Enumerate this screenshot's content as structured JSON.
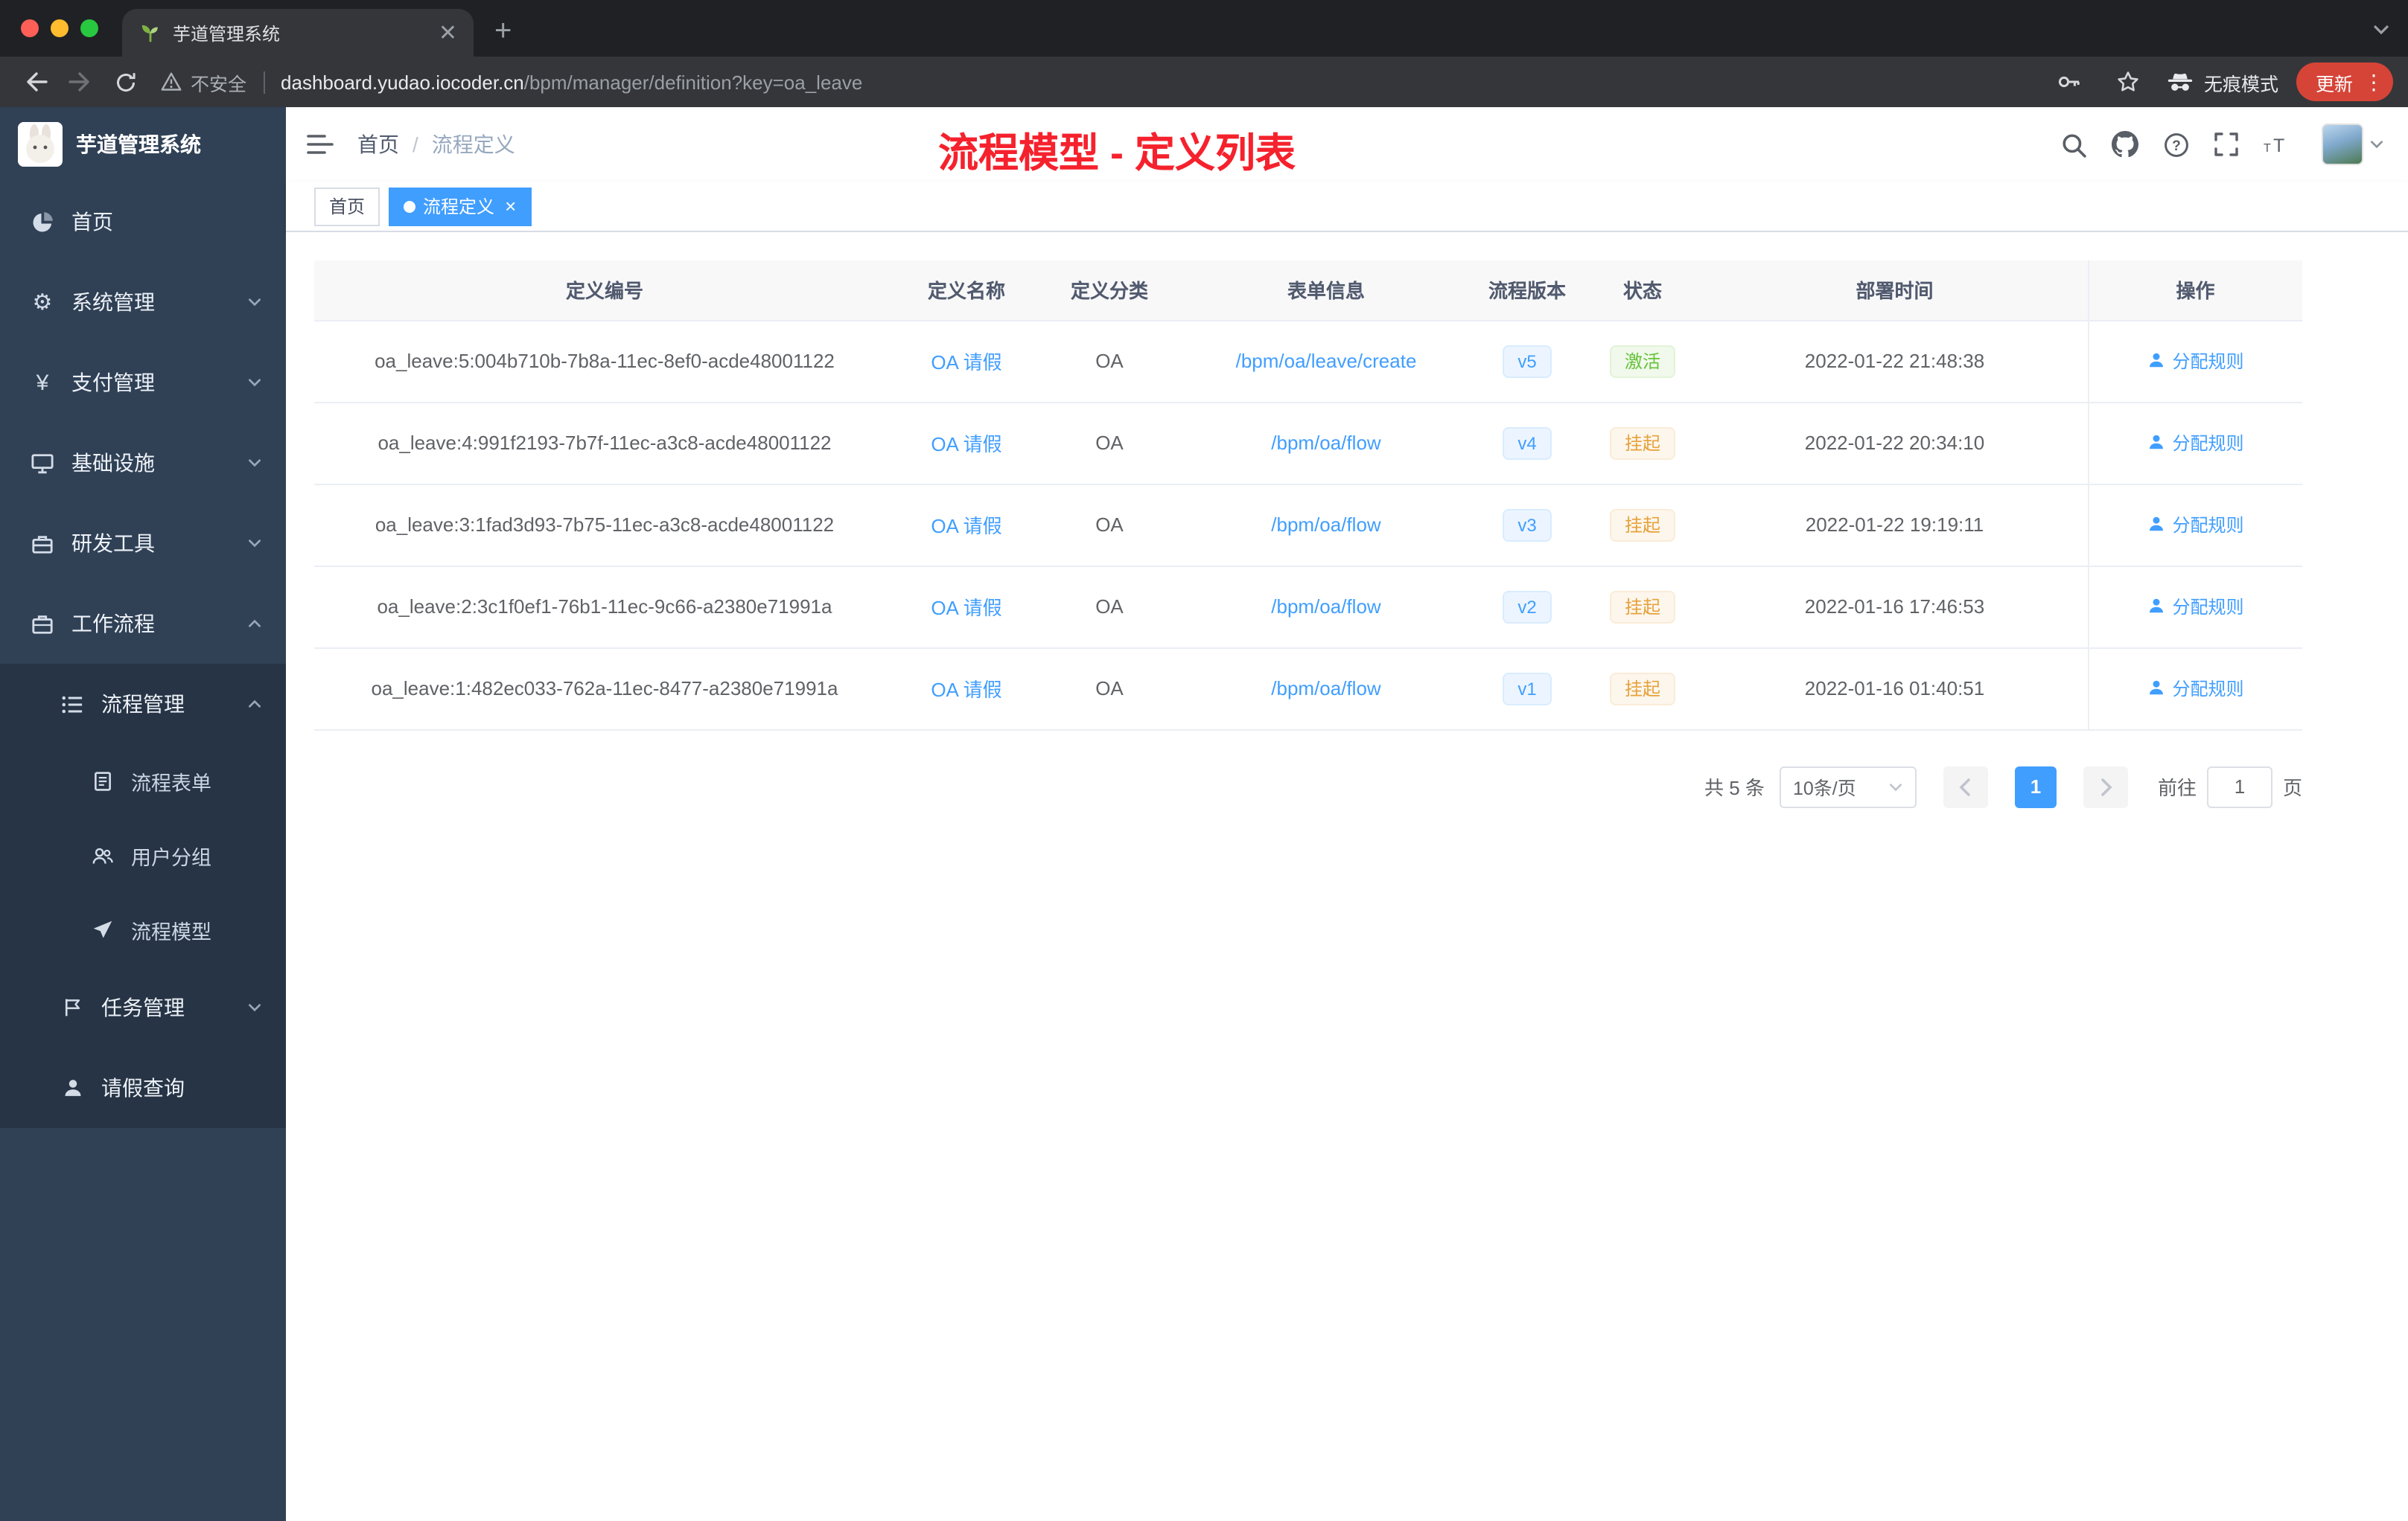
{
  "browser": {
    "tab_title": "芋道管理系统",
    "security_label": "不安全",
    "url_host": "dashboard.yudao.iocoder.cn",
    "url_path": "/bpm/manager/definition?key=oa_leave",
    "incognito_label": "无痕模式",
    "update_label": "更新"
  },
  "sidebar": {
    "logo_title": "芋道管理系统",
    "items": [
      {
        "label": "首页"
      },
      {
        "label": "系统管理"
      },
      {
        "label": "支付管理"
      },
      {
        "label": "基础设施"
      },
      {
        "label": "研发工具"
      },
      {
        "label": "工作流程"
      },
      {
        "label": "流程管理"
      },
      {
        "label": "流程表单"
      },
      {
        "label": "用户分组"
      },
      {
        "label": "流程模型"
      },
      {
        "label": "任务管理"
      },
      {
        "label": "请假查询"
      }
    ]
  },
  "header": {
    "breadcrumb_home": "首页",
    "breadcrumb_current": "流程定义",
    "annotation": "流程模型 - 定义列表"
  },
  "tags": [
    {
      "label": "首页"
    },
    {
      "label": "流程定义"
    }
  ],
  "table": {
    "columns": [
      "定义编号",
      "定义名称",
      "定义分类",
      "表单信息",
      "流程版本",
      "状态",
      "部署时间",
      "操作"
    ],
    "action_label": "分配规则",
    "rows": [
      {
        "id": "oa_leave:5:004b710b-7b8a-11ec-8ef0-acde48001122",
        "name": "OA 请假",
        "category": "OA",
        "form": "/bpm/oa/leave/create",
        "version": "v5",
        "status": "激活",
        "status_type": "active",
        "time": "2022-01-22 21:48:38"
      },
      {
        "id": "oa_leave:4:991f2193-7b7f-11ec-a3c8-acde48001122",
        "name": "OA 请假",
        "category": "OA",
        "form": "/bpm/oa/flow",
        "version": "v4",
        "status": "挂起",
        "status_type": "suspended",
        "time": "2022-01-22 20:34:10"
      },
      {
        "id": "oa_leave:3:1fad3d93-7b75-11ec-a3c8-acde48001122",
        "name": "OA 请假",
        "category": "OA",
        "form": "/bpm/oa/flow",
        "version": "v3",
        "status": "挂起",
        "status_type": "suspended",
        "time": "2022-01-22 19:19:11"
      },
      {
        "id": "oa_leave:2:3c1f0ef1-76b1-11ec-9c66-a2380e71991a",
        "name": "OA 请假",
        "category": "OA",
        "form": "/bpm/oa/flow",
        "version": "v2",
        "status": "挂起",
        "status_type": "suspended",
        "time": "2022-01-16 17:46:53"
      },
      {
        "id": "oa_leave:1:482ec033-762a-11ec-8477-a2380e71991a",
        "name": "OA 请假",
        "category": "OA",
        "form": "/bpm/oa/flow",
        "version": "v1",
        "status": "挂起",
        "status_type": "suspended",
        "time": "2022-01-16 01:40:51"
      }
    ]
  },
  "pagination": {
    "total_label": "共 5 条",
    "page_size": "10条/页",
    "current_page": "1",
    "goto_label": "前往",
    "goto_value": "1",
    "page_unit": "页"
  },
  "colors": {
    "accent_blue": "#409eff",
    "success_green": "#67c23a",
    "warning_yellow": "#e6a23c",
    "sidebar_bg": "#304156",
    "annotation_red": "#f5222d"
  }
}
